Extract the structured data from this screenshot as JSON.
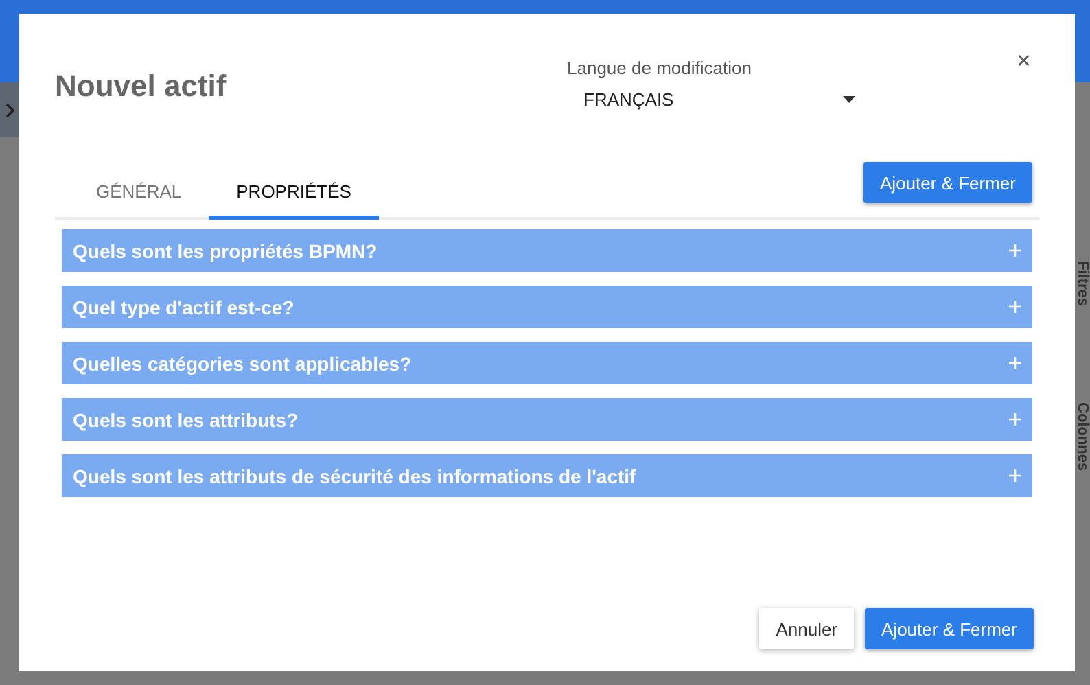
{
  "background": {
    "side_labels": [
      "Filtres",
      "Colonnes"
    ]
  },
  "dialog": {
    "title": "Nouvel actif",
    "language": {
      "label": "Langue de modification",
      "value": "FRANÇAIS"
    },
    "close": "×",
    "tabs": [
      {
        "label": "GÉNÉRAL",
        "selected": false
      },
      {
        "label": "PROPRIÉTÉS",
        "selected": true
      }
    ],
    "top_button": "Ajouter & Fermer",
    "sections": [
      {
        "title": "Quels sont les propriétés BPMN?",
        "expanded": false
      },
      {
        "title": "Quel type d'actif est-ce?",
        "expanded": false
      },
      {
        "title": "Quelles catégories sont applicables?",
        "expanded": false
      },
      {
        "title": "Quels sont les attributs?",
        "expanded": false
      },
      {
        "title": "Quels sont les attributs de sécurité des informations de l'actif",
        "expanded": false
      }
    ],
    "footer_buttons": [
      {
        "label": "Annuler",
        "kind": "secondary"
      },
      {
        "label": "Ajouter & Fermer",
        "kind": "primary"
      }
    ]
  }
}
